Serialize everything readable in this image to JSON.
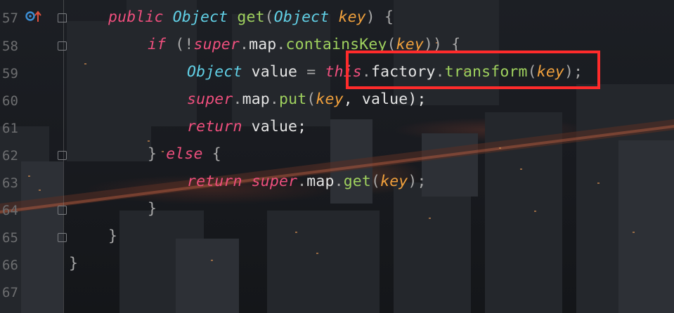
{
  "editor": {
    "line_numbers": [
      "57",
      "58",
      "59",
      "60",
      "61",
      "62",
      "63",
      "64",
      "65",
      "66",
      "67"
    ],
    "icons": {
      "override": "override-marker-icon",
      "fold": "fold-marker-icon"
    },
    "lines": [
      [
        {
          "t": "public",
          "c": "kw"
        },
        {
          "t": " ",
          "c": "plain"
        },
        {
          "t": "Object",
          "c": "type"
        },
        {
          "t": " ",
          "c": "plain"
        },
        {
          "t": "get",
          "c": "fn"
        },
        {
          "t": "(",
          "c": "punc"
        },
        {
          "t": "Object",
          "c": "type"
        },
        {
          "t": " ",
          "c": "plain"
        },
        {
          "t": "key",
          "c": "param"
        },
        {
          "t": ") {",
          "c": "punc"
        }
      ],
      [
        {
          "t": "if",
          "c": "kw"
        },
        {
          "t": " (!",
          "c": "punc"
        },
        {
          "t": "super",
          "c": "kw"
        },
        {
          "t": ".",
          "c": "punc"
        },
        {
          "t": "map",
          "c": "plain"
        },
        {
          "t": ".",
          "c": "punc"
        },
        {
          "t": "containsKey",
          "c": "fn"
        },
        {
          "t": "(",
          "c": "punc"
        },
        {
          "t": "key",
          "c": "param"
        },
        {
          "t": ")) {",
          "c": "punc"
        }
      ],
      [
        {
          "t": "Object",
          "c": "type"
        },
        {
          "t": " value ",
          "c": "plain"
        },
        {
          "t": "=",
          "c": "punc"
        },
        {
          "t": " ",
          "c": "plain"
        },
        {
          "t": "this",
          "c": "kw"
        },
        {
          "t": ".",
          "c": "punc"
        },
        {
          "t": "factory",
          "c": "plain"
        },
        {
          "t": ".",
          "c": "punc"
        },
        {
          "t": "transform",
          "c": "fn"
        },
        {
          "t": "(",
          "c": "punc"
        },
        {
          "t": "key",
          "c": "param"
        },
        {
          "t": ");",
          "c": "punc"
        }
      ],
      [
        {
          "t": "super",
          "c": "kw"
        },
        {
          "t": ".",
          "c": "punc"
        },
        {
          "t": "map",
          "c": "plain"
        },
        {
          "t": ".",
          "c": "punc"
        },
        {
          "t": "put",
          "c": "fn"
        },
        {
          "t": "(",
          "c": "punc"
        },
        {
          "t": "key",
          "c": "param"
        },
        {
          "t": ", value);",
          "c": "plain"
        }
      ],
      [
        {
          "t": "return",
          "c": "kw"
        },
        {
          "t": " value;",
          "c": "plain"
        }
      ],
      [
        {
          "t": "} ",
          "c": "punc"
        },
        {
          "t": "else",
          "c": "kw"
        },
        {
          "t": " {",
          "c": "punc"
        }
      ],
      [
        {
          "t": "return",
          "c": "kw"
        },
        {
          "t": " ",
          "c": "plain"
        },
        {
          "t": "super",
          "c": "kw"
        },
        {
          "t": ".",
          "c": "punc"
        },
        {
          "t": "map",
          "c": "plain"
        },
        {
          "t": ".",
          "c": "punc"
        },
        {
          "t": "get",
          "c": "fn"
        },
        {
          "t": "(",
          "c": "punc"
        },
        {
          "t": "key",
          "c": "param"
        },
        {
          "t": ");",
          "c": "punc"
        }
      ],
      [
        {
          "t": "}",
          "c": "punc"
        }
      ],
      [
        {
          "t": "}",
          "c": "punc"
        }
      ],
      [
        {
          "t": "}",
          "c": "punc"
        }
      ],
      []
    ],
    "highlight_color": "#ff2b2b"
  }
}
